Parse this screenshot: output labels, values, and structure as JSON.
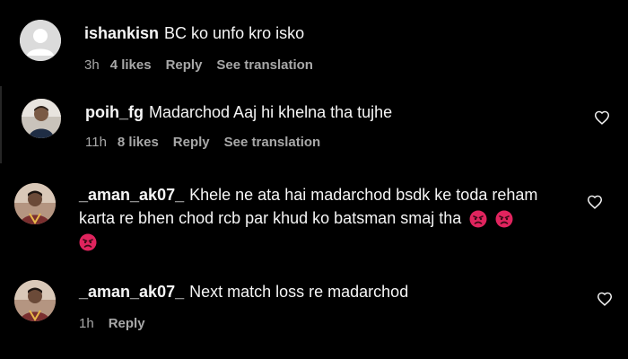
{
  "comments": [
    {
      "username": "ishankisn",
      "text": "BC ko unfo kro isko",
      "time": "3h",
      "likes": "4 likes",
      "reply": "Reply",
      "translation": "See translation"
    },
    {
      "username": "poih_fg",
      "text": "Madarchod Aaj hi khelna tha tujhe",
      "time": "11h",
      "likes": "8 likes",
      "reply": "Reply",
      "translation": "See translation"
    },
    {
      "username": "_aman_ak07_",
      "text_line1": "Khele ne ata hai madarchod bsdk ke toda reham",
      "text_line2": "karta re bhen chod rcb par khud ko batsman smaj tha"
    },
    {
      "username": "_aman_ak07_",
      "text": "Next match loss re madarchod",
      "time": "1h",
      "reply": "Reply"
    }
  ],
  "icons": {
    "like": "heart-outline-icon",
    "emoji": "angry-face-emoji"
  },
  "colors": {
    "background": "#000000",
    "text": "#f5f5f5",
    "meta": "#a8a8a8",
    "angry_emoji": "#e0245e"
  }
}
